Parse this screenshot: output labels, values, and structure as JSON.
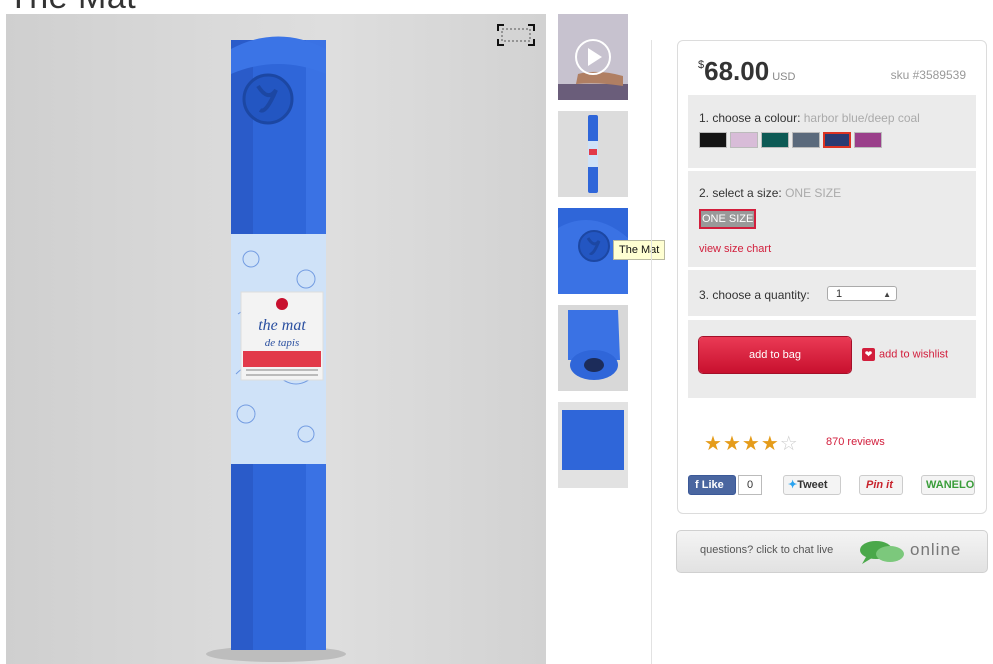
{
  "page": {
    "title": "The Mat"
  },
  "main_image": {
    "alt": "The Mat"
  },
  "thumbnails": [
    {
      "label": "video thumbnail"
    },
    {
      "label": "rolled mat thumbnail"
    },
    {
      "label": "mat logo close-up thumbnail"
    },
    {
      "label": "mat partially unrolled thumbnail"
    },
    {
      "label": "mat flat thumbnail"
    }
  ],
  "tooltip": "The Mat",
  "product": {
    "currency_symbol": "$",
    "price": "68.00",
    "currency": "USD",
    "sku": "sku #3589539"
  },
  "colour": {
    "label": "1. choose a colour:",
    "selected": "harbor blue/deep coal",
    "swatches": [
      {
        "color": "#141414"
      },
      {
        "color": "#d8bcd8"
      },
      {
        "color": "#0d5a55"
      },
      {
        "color": "#5b6a7c"
      },
      {
        "color": "#2a3b72",
        "selected": true
      },
      {
        "color": "#9a3f8a"
      }
    ]
  },
  "size": {
    "label": "2. select a size:",
    "selected": "ONE SIZE",
    "button": "ONE SIZE",
    "chart_link": "view size chart"
  },
  "quantity": {
    "label": "3. choose a quantity:",
    "value": "1"
  },
  "actions": {
    "add_to_bag": "add to bag",
    "add_to_wishlist": "add to wishlist"
  },
  "rating": {
    "stars": 4,
    "max": 5,
    "reviews": "870 reviews"
  },
  "social": {
    "like": "Like",
    "like_count": "0",
    "tweet": "Tweet",
    "pin": "Pin it",
    "wanelo": "WANELO"
  },
  "chat": {
    "question": "questions? click to chat live",
    "status": "online"
  }
}
